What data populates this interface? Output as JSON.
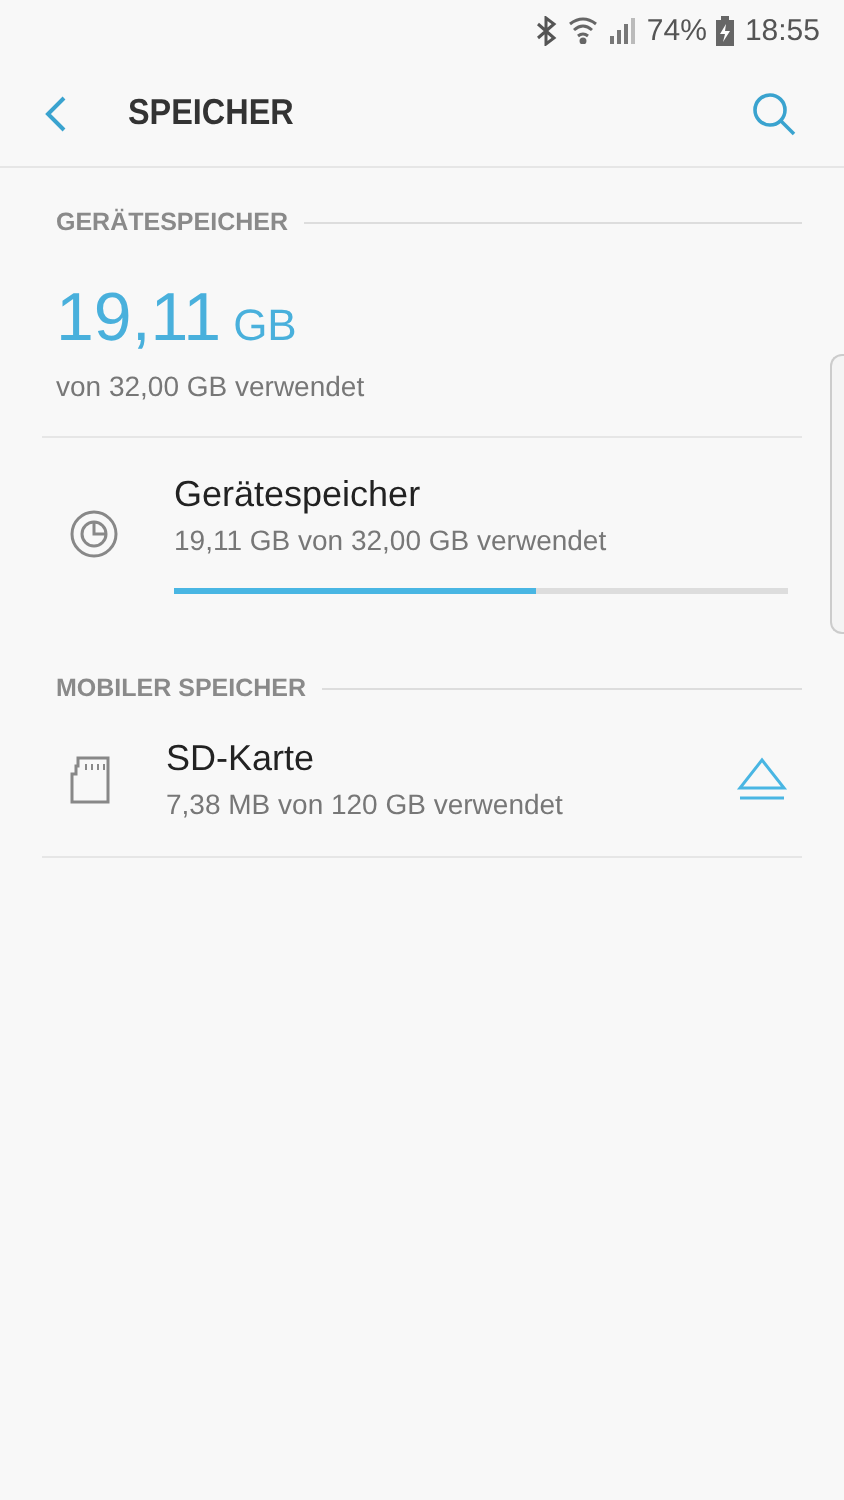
{
  "status_bar": {
    "battery": "74%",
    "time": "18:55"
  },
  "header": {
    "title": "SPEICHER"
  },
  "sections": [
    {
      "title": "GERÄTESPEICHER",
      "summary": {
        "value": "19,11",
        "unit": "GB",
        "caption": "von 32,00 GB verwendet"
      },
      "items": [
        {
          "kind": "internal",
          "title": "Gerätespeicher",
          "subtitle": "19,11 GB von 32,00 GB verwendet",
          "level": 0.59
        }
      ]
    },
    {
      "title": "MOBILER SPEICHER",
      "items": [
        {
          "kind": "sdcard",
          "title": "SD-Karte",
          "subtitle": "7,38 MB von 120 GB verwendet",
          "eject": true
        }
      ]
    }
  ]
}
